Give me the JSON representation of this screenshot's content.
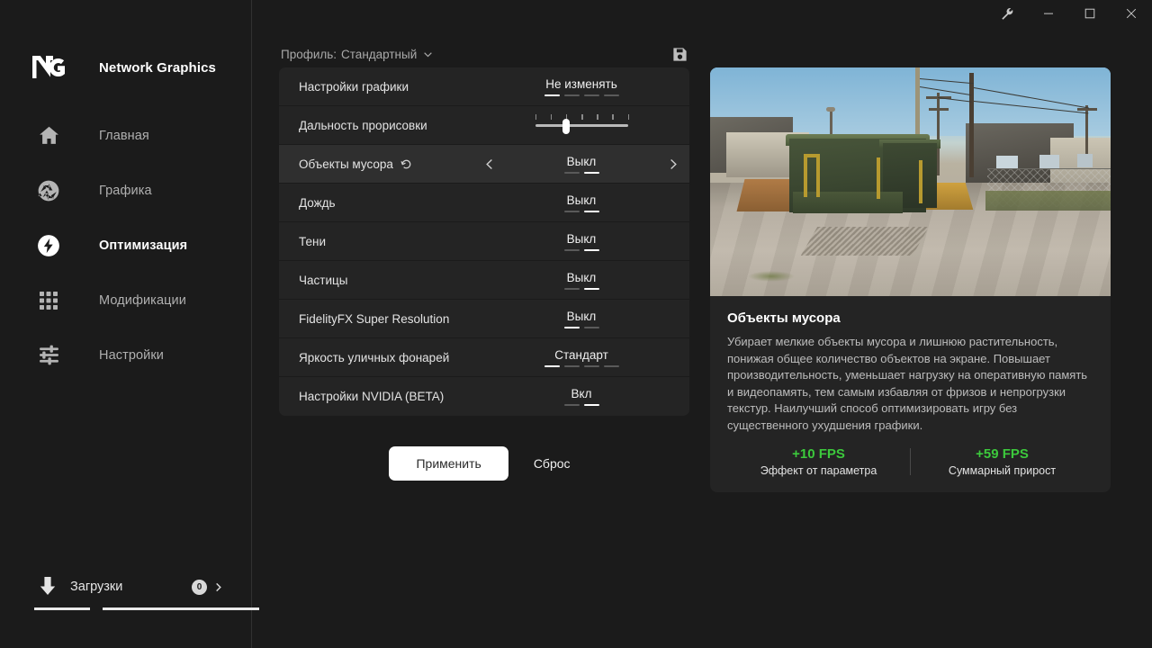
{
  "window": {
    "controls": [
      {
        "name": "wrench-icon",
        "label": "Tools"
      },
      {
        "name": "minimize-button",
        "label": "Minimize"
      },
      {
        "name": "maximize-button",
        "label": "Maximize"
      },
      {
        "name": "close-button",
        "label": "Close"
      }
    ]
  },
  "sidebar": {
    "brand": "Network Graphics",
    "items": [
      {
        "label": "Главная",
        "icon": "home-icon",
        "active": false
      },
      {
        "label": "Графика",
        "icon": "aperture-icon",
        "active": false
      },
      {
        "label": "Оптимизация",
        "icon": "bolt-icon",
        "active": true
      },
      {
        "label": "Модификации",
        "icon": "grid-icon",
        "active": false
      },
      {
        "label": "Настройки",
        "icon": "sliders-icon",
        "active": false
      }
    ],
    "downloads": {
      "label": "Загрузки",
      "badge": "0"
    }
  },
  "profile": {
    "prefix": "Профиль:",
    "value": "Стандартный",
    "save_tooltip": "Сохранить"
  },
  "settings": [
    {
      "label": "Настройки графики",
      "control": "value",
      "value": "Не изменять",
      "steps": 4,
      "index": 0,
      "selected": false,
      "modified": false
    },
    {
      "label": "Дальность прорисовки",
      "control": "slider",
      "ticks": 7,
      "position": 2,
      "selected": false,
      "modified": false
    },
    {
      "label": "Объекты мусора",
      "control": "value",
      "value": "Выкл",
      "steps": 2,
      "index": 1,
      "selected": true,
      "modified": true
    },
    {
      "label": "Дождь",
      "control": "value",
      "value": "Выкл",
      "steps": 2,
      "index": 1,
      "selected": false,
      "modified": false
    },
    {
      "label": "Тени",
      "control": "value",
      "value": "Выкл",
      "steps": 2,
      "index": 1,
      "selected": false,
      "modified": false
    },
    {
      "label": "Частицы",
      "control": "value",
      "value": "Выкл",
      "steps": 2,
      "index": 1,
      "selected": false,
      "modified": false
    },
    {
      "label": "FidelityFX Super Resolution",
      "control": "value",
      "value": "Выкл",
      "steps": 2,
      "index": 0,
      "selected": false,
      "modified": false
    },
    {
      "label": "Яркость уличных фонарей",
      "control": "value",
      "value": "Стандарт",
      "steps": 4,
      "index": 0,
      "selected": false,
      "modified": false
    },
    {
      "label": "Настройки NVIDIA (BETA)",
      "control": "value",
      "value": "Вкл",
      "steps": 2,
      "index": 1,
      "selected": false,
      "modified": false
    }
  ],
  "actions": {
    "apply": "Применить",
    "reset": "Сброс"
  },
  "preview": {
    "title": "Объекты мусора",
    "description": "Убирает мелкие объекты мусора и лишнюю растительность, понижая общее количество объектов на экране. Повышает производительность, уменьшает нагрузку на оперативную память и видеопамять, тем самым избавляя от фризов и непрогрузки текстур. Наилучший способ оптимизировать игру без существенного ухудшения графики.",
    "stats": [
      {
        "value": "+10 FPS",
        "caption": "Эффект от параметра"
      },
      {
        "value": "+59 FPS",
        "caption": "Суммарный прирост"
      }
    ]
  },
  "colors": {
    "background": "#1b1b1b",
    "card": "#242424",
    "row_selected": "#2f2f2f",
    "accent_green": "#3cc93c",
    "text_primary": "#ffffff",
    "text_secondary": "#b0b0b0"
  }
}
